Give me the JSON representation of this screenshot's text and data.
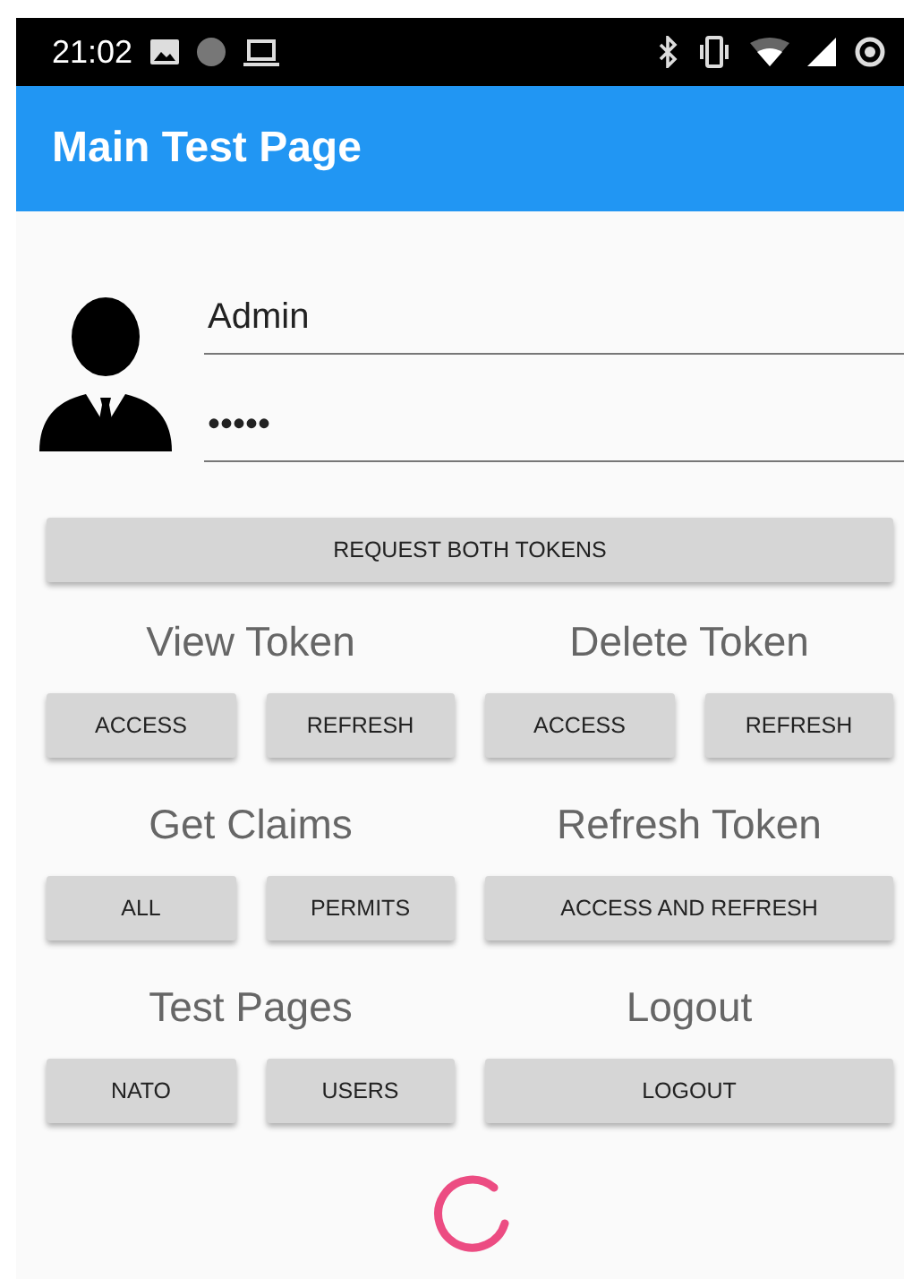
{
  "status_bar": {
    "time": "21:02"
  },
  "app_bar": {
    "title": "Main Test Page"
  },
  "login": {
    "username": "Admin",
    "password": "•••••"
  },
  "request_button": "REQUEST BOTH TOKENS",
  "sections": [
    {
      "title": "View Token",
      "buttons": [
        "ACCESS",
        "REFRESH"
      ]
    },
    {
      "title": "Delete Token",
      "buttons": [
        "ACCESS",
        "REFRESH"
      ]
    },
    {
      "title": "Get Claims",
      "buttons": [
        "ALL",
        "PERMITS"
      ]
    },
    {
      "title": "Refresh Token",
      "buttons": [
        "ACCESS AND REFRESH"
      ]
    },
    {
      "title": "Test Pages",
      "buttons": [
        "NATO",
        "USERS"
      ]
    },
    {
      "title": "Logout",
      "buttons": [
        "LOGOUT"
      ]
    }
  ]
}
